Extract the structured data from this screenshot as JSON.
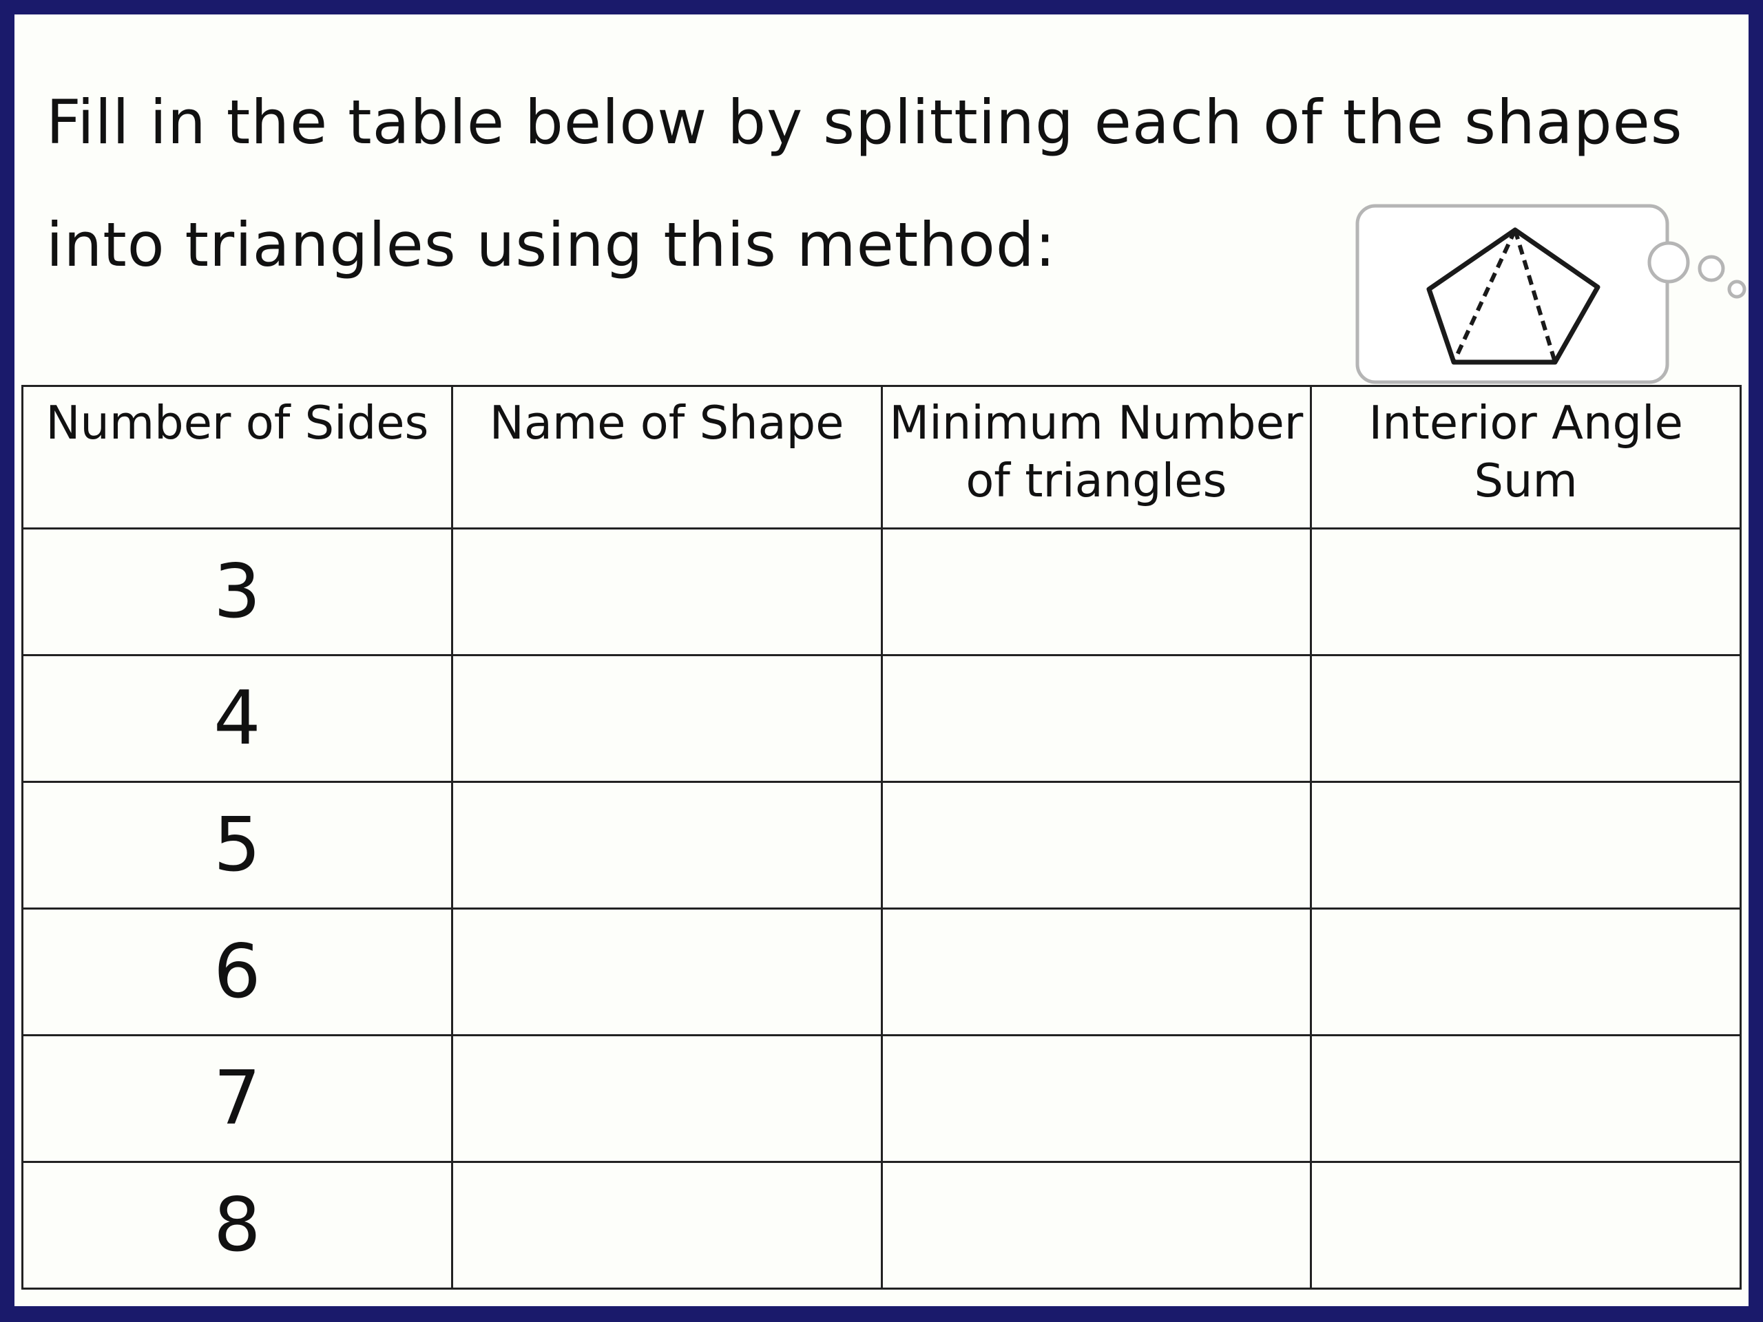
{
  "instructions": {
    "line1": "Fill in the table below by splitting each of the shapes",
    "line2": "into triangles using this method:"
  },
  "illustration": {
    "icon": "pentagon-split-into-triangles-icon",
    "frame": "thought-bubble"
  },
  "table": {
    "headers": [
      "Number of Sides",
      "Name of Shape",
      "Minimum Number of triangles",
      "Interior Angle Sum"
    ],
    "rows": [
      {
        "sides": "3",
        "name": "",
        "triangles": "",
        "angle_sum": ""
      },
      {
        "sides": "4",
        "name": "",
        "triangles": "",
        "angle_sum": ""
      },
      {
        "sides": "5",
        "name": "",
        "triangles": "",
        "angle_sum": ""
      },
      {
        "sides": "6",
        "name": "",
        "triangles": "",
        "angle_sum": ""
      },
      {
        "sides": "7",
        "name": "",
        "triangles": "",
        "angle_sum": ""
      },
      {
        "sides": "8",
        "name": "",
        "triangles": "",
        "angle_sum": ""
      }
    ]
  },
  "colors": {
    "frame_border": "#1a1a6b",
    "page_background": "#fdfefa",
    "bubble_outline": "#b5b5b5",
    "table_lines": "#222222"
  }
}
